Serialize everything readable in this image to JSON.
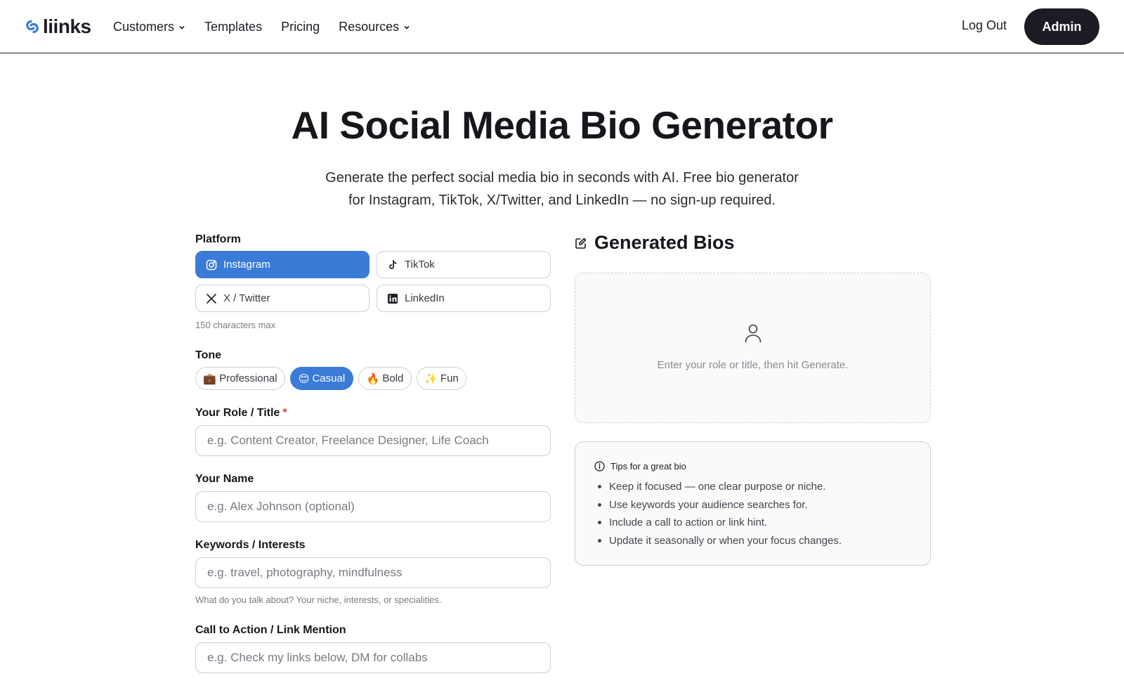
{
  "nav": {
    "logo": "liinks",
    "links": [
      {
        "label": "Customers",
        "dropdown": true
      },
      {
        "label": "Templates",
        "dropdown": false
      },
      {
        "label": "Pricing",
        "dropdown": false
      },
      {
        "label": "Resources",
        "dropdown": true
      }
    ],
    "logout": "Log Out",
    "admin": "Admin"
  },
  "hero": {
    "title_part1": "AI Social Media ",
    "title_highlight": "Bio Generator",
    "subtitle_line1": "Generate the perfect social media bio in seconds with AI. Free bio generator",
    "subtitle_line2": "for Instagram, TikTok, X/Twitter, and LinkedIn — no sign-up required."
  },
  "form": {
    "platform_label": "Platform",
    "platforms": [
      {
        "label": "Instagram",
        "icon": "instagram-icon",
        "active": true
      },
      {
        "label": "TikTok",
        "icon": "tiktok-icon",
        "active": false
      },
      {
        "label": "X / Twitter",
        "icon": "x-icon",
        "active": false
      },
      {
        "label": "LinkedIn",
        "icon": "linkedin-icon",
        "active": false
      }
    ],
    "char_limit": "150 characters max",
    "tone_label": "Tone",
    "tones": [
      {
        "emoji": "💼",
        "label": "Professional",
        "active": false
      },
      {
        "emoji": "😊",
        "label": "Casual",
        "active": true
      },
      {
        "emoji": "🔥",
        "label": "Bold",
        "active": false
      },
      {
        "emoji": "✨",
        "label": "Fun",
        "active": false
      }
    ],
    "role_label": "Your Role / Title",
    "role_required": "*",
    "role_placeholder": "e.g. Content Creator, Freelance Designer, Life Coach",
    "name_label": "Your Name",
    "name_placeholder": "e.g. Alex Johnson (optional)",
    "keywords_label": "Keywords / Interests",
    "keywords_placeholder": "e.g. travel, photography, mindfulness",
    "keywords_hint": "What do you talk about? Your niche, interests, or specialities.",
    "cta_label": "Call to Action / Link Mention",
    "cta_placeholder": "e.g. Check my links below, DM for collabs"
  },
  "output": {
    "title": "Generated Bios",
    "empty_text": "Enter your role or title, then hit Generate.",
    "tips_title": "Tips for a great bio",
    "tips": [
      "Keep it focused — one clear purpose or niche.",
      "Use keywords your audience searches for.",
      "Include a call to action or link hint.",
      "Update it seasonally or when your focus changes."
    ]
  },
  "colors": {
    "accent": "#3b7bd8",
    "dark": "#1c1c24",
    "highlight": "#d6b3f5",
    "required": "#d63b3b"
  }
}
